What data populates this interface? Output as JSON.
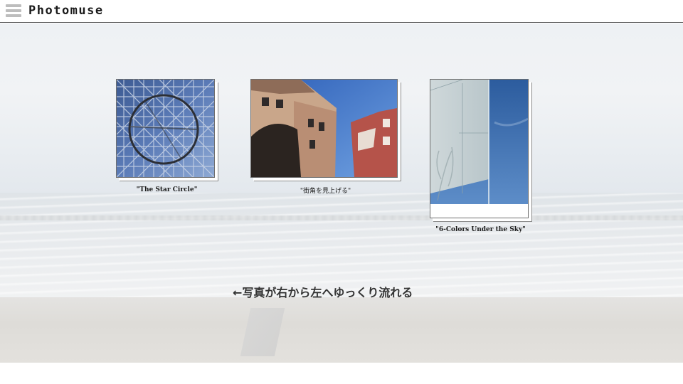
{
  "header": {
    "app_title": "Photomuse",
    "menu_icon": "hamburger-menu-icon"
  },
  "gallery": {
    "photos": [
      {
        "caption": "\"The Star Circle\"",
        "subject": "geodesic-steel-frame-with-ring"
      },
      {
        "caption": "\"街角を見上げる\"",
        "subject": "building-corner-under-blue-sky"
      },
      {
        "caption": "\"6-Colors Under the Sky\"",
        "subject": "wall-and-blue-sky"
      }
    ]
  },
  "hint": {
    "text": "←写真が右から左へゆっくり流れる"
  },
  "colors": {
    "header_border": "#555555",
    "text": "#1a1a1a"
  }
}
